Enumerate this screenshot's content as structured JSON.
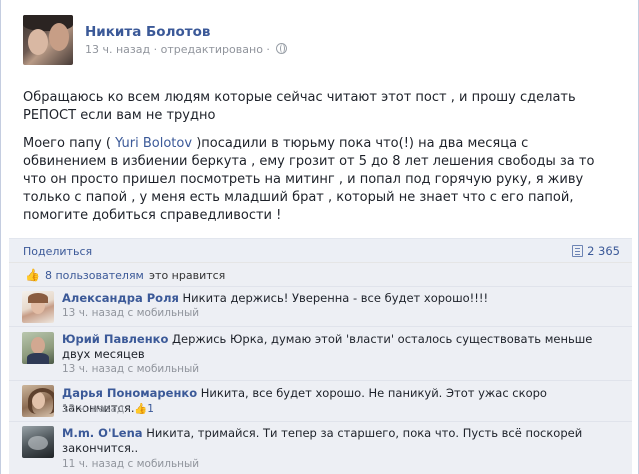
{
  "post": {
    "author": "Никита Болотов",
    "time": "13 ч. назад",
    "edited": "отредактировано",
    "separator": "·",
    "paragraph1": "Обращаюсь ко всем людям которые сейчас читают этот пост , и прошу сделать РЕПОСТ если вам не трудно",
    "paragraph2_before": "Моего папу ( ",
    "mention": "Yuri Bolotov",
    "paragraph2_after": " )посадили в тюрьму пока что(!) на два месяца с обвинением в избиении беркута , ему грозит от 5 до 8 лет лешения свободы за то что он просто пришел посмотреть на митинг , и попал под горячую руку, я живу только с папой , у меня есть младший брат , который не знает что с его папой, помогите добиться справедливости !"
  },
  "actions": {
    "share_label": "Поделиться",
    "share_count": "2 365"
  },
  "likes": {
    "likers": "8 пользователям",
    "suffix": "это нравится"
  },
  "comments": [
    {
      "name": "Александра Роля",
      "text": " Никита держись! Уверенна - все будет хорошо!!!!",
      "meta": "13 ч. назад с мобильный"
    },
    {
      "name": "Юрий Павленко",
      "text": " Держись Юрка, думаю этой 'власти' осталось существовать меньше двух месяцев",
      "meta": "13 ч. назад с мобильный"
    },
    {
      "name": "Дарья Пономаренко",
      "text": " Никита, все будет хорошо. Не паникуй. Этот ужас скоро закончится.",
      "meta": "12 ч. назад · ",
      "like_count": "1"
    },
    {
      "name": "M.m. O'Lena",
      "text": " Никита, тримайся. Ти тепер за старшего, пока что. Пусть всё поскорей закончится..",
      "meta": "11 ч. назад с мобильный"
    }
  ]
}
